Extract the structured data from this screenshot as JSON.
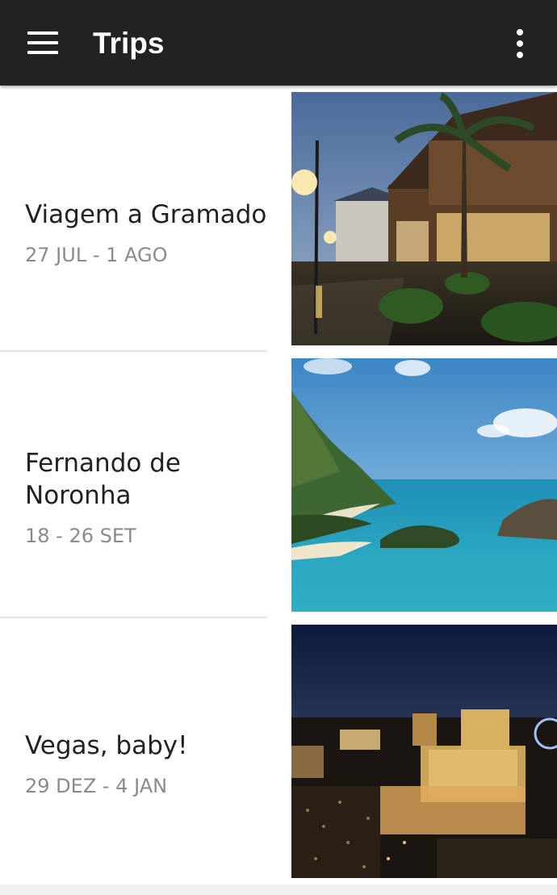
{
  "appbar": {
    "title": "Trips",
    "menu_icon": "hamburger-menu-icon",
    "more_icon": "more-vertical-icon",
    "background": "#222222"
  },
  "trips": [
    {
      "name": "Viagem a Gramado",
      "dates": "27 JUL - 1 AGO"
    },
    {
      "name": "Fernando de Noronha",
      "dates": "18 - 26 SET"
    },
    {
      "name": "Vegas, baby!",
      "dates": "29 DEZ - 4 JAN"
    }
  ]
}
